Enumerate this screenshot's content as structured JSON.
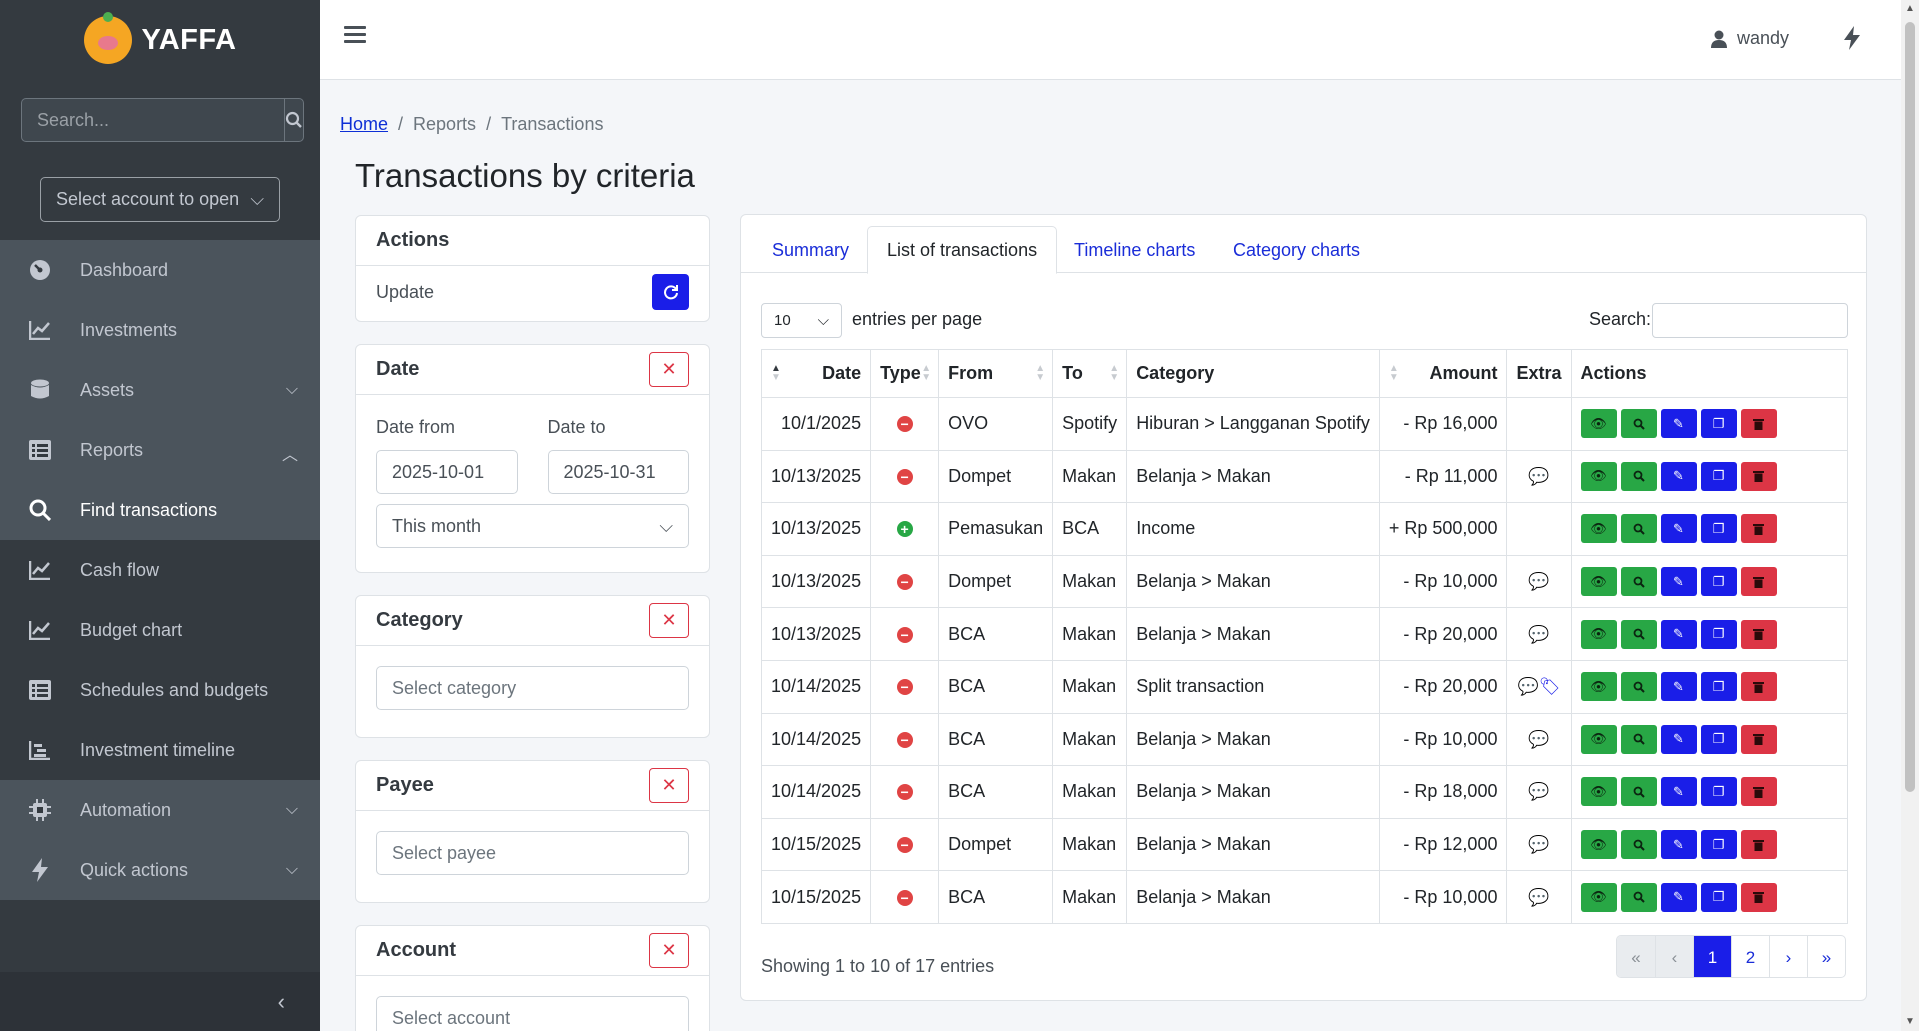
{
  "sidebar": {
    "brand": "YAFFA",
    "search_placeholder": "Search...",
    "account_select": "Select account to open",
    "nav": [
      {
        "label": "Dashboard",
        "icon": "gauge-icon"
      },
      {
        "label": "Investments",
        "icon": "chart-line-icon"
      },
      {
        "label": "Assets",
        "icon": "database-icon",
        "chevron": "down"
      },
      {
        "label": "Reports",
        "icon": "list-icon",
        "chevron": "up"
      },
      {
        "label": "Find transactions",
        "icon": "search-icon"
      },
      {
        "label": "Cash flow",
        "icon": "chart-line-icon"
      },
      {
        "label": "Budget chart",
        "icon": "chart-line-icon"
      },
      {
        "label": "Schedules and budgets",
        "icon": "list-icon"
      },
      {
        "label": "Investment timeline",
        "icon": "timeline-icon"
      },
      {
        "label": "Automation",
        "icon": "chip-icon",
        "chevron": "down"
      },
      {
        "label": "Quick actions",
        "icon": "bolt-icon",
        "chevron": "down"
      }
    ]
  },
  "topbar": {
    "user": "wandy"
  },
  "breadcrumb": {
    "home": "Home",
    "reports": "Reports",
    "current": "Transactions"
  },
  "page_title": "Transactions by criteria",
  "actions": {
    "title": "Actions",
    "update": "Update"
  },
  "date": {
    "title": "Date",
    "from_label": "Date from",
    "to_label": "Date to",
    "from": "2025-10-01",
    "to": "2025-10-31",
    "preset": "This month"
  },
  "category": {
    "title": "Category",
    "placeholder": "Select category"
  },
  "payee": {
    "title": "Payee",
    "placeholder": "Select payee"
  },
  "account": {
    "title": "Account",
    "placeholder": "Select account"
  },
  "tabs": [
    "Summary",
    "List of transactions",
    "Timeline charts",
    "Category charts"
  ],
  "table_controls": {
    "per_page": "10",
    "per_page_label": "entries per page",
    "search_label": "Search:"
  },
  "columns": [
    "Date",
    "Type",
    "From",
    "To",
    "Category",
    "Amount",
    "Extra",
    "Actions"
  ],
  "rows": [
    {
      "date": "10/1/2025",
      "type": "withdrawal",
      "from": "OVO",
      "to": "Spotify",
      "category": "Hiburan > Langganan Spotify",
      "amount": "- Rp 16,000",
      "extra": []
    },
    {
      "date": "10/13/2025",
      "type": "withdrawal",
      "from": "Dompet",
      "to": "Makan",
      "category": "Belanja > Makan",
      "amount": "- Rp 11,000",
      "extra": [
        "comment"
      ]
    },
    {
      "date": "10/13/2025",
      "type": "deposit",
      "from": "Pemasukan",
      "to": "BCA",
      "category": "Income",
      "amount": "+ Rp 500,000",
      "extra": []
    },
    {
      "date": "10/13/2025",
      "type": "withdrawal",
      "from": "Dompet",
      "to": "Makan",
      "category": "Belanja > Makan",
      "amount": "- Rp 10,000",
      "extra": [
        "comment"
      ]
    },
    {
      "date": "10/13/2025",
      "type": "withdrawal",
      "from": "BCA",
      "to": "Makan",
      "category": "Belanja > Makan",
      "amount": "- Rp 20,000",
      "extra": [
        "comment"
      ]
    },
    {
      "date": "10/14/2025",
      "type": "withdrawal",
      "from": "BCA",
      "to": "Makan",
      "category": "Split transaction",
      "amount": "- Rp 20,000",
      "extra": [
        "comment",
        "tags"
      ]
    },
    {
      "date": "10/14/2025",
      "type": "withdrawal",
      "from": "BCA",
      "to": "Makan",
      "category": "Belanja > Makan",
      "amount": "- Rp 10,000",
      "extra": [
        "comment"
      ]
    },
    {
      "date": "10/14/2025",
      "type": "withdrawal",
      "from": "BCA",
      "to": "Makan",
      "category": "Belanja > Makan",
      "amount": "- Rp 18,000",
      "extra": [
        "comment"
      ]
    },
    {
      "date": "10/15/2025",
      "type": "withdrawal",
      "from": "Dompet",
      "to": "Makan",
      "category": "Belanja > Makan",
      "amount": "- Rp 12,000",
      "extra": [
        "comment"
      ]
    },
    {
      "date": "10/15/2025",
      "type": "withdrawal",
      "from": "BCA",
      "to": "Makan",
      "category": "Belanja > Makan",
      "amount": "- Rp 10,000",
      "extra": [
        "comment"
      ]
    }
  ],
  "footer": {
    "showing": "Showing 1 to 10 of 17 entries"
  },
  "pagination": [
    "«",
    "‹",
    "1",
    "2",
    "›",
    "»"
  ],
  "colors": {
    "sidebar_bg": "#343a40",
    "primary": "#1a1ee8",
    "success": "#28a745",
    "danger": "#dc3545"
  }
}
